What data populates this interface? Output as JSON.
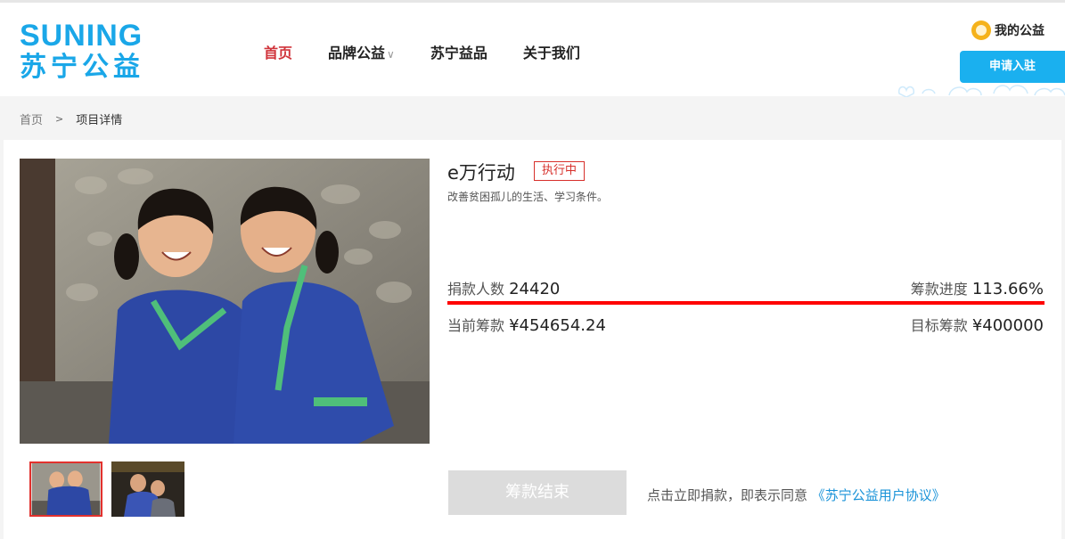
{
  "header": {
    "logo_en": "SUNING",
    "logo_cn": "苏宁公益",
    "nav": [
      {
        "label": "首页",
        "active": true
      },
      {
        "label": "品牌公益",
        "chevron": "∨"
      },
      {
        "label": "苏宁益品"
      },
      {
        "label": "关于我们"
      }
    ],
    "my_charity": "我的公益",
    "apply_button": "申请入驻"
  },
  "breadcrumb": {
    "home": "首页",
    "separator": ">",
    "current": "项目详情"
  },
  "project": {
    "title": "e万行动",
    "status": "执行中",
    "description": "改善贫困孤儿的生活、学习条件。",
    "donors_label": "捐款人数",
    "donors_value": "24420",
    "progress_label": "筹款进度",
    "progress_value": "113.66%",
    "progress_fraction": 1.0,
    "raised_label": "当前筹款",
    "raised_value": "¥454654.24",
    "target_label": "目标筹款",
    "target_value": "¥400000",
    "end_button": "筹款结束",
    "agree_text": "点击立即捐款，即表示同意",
    "agree_link": "《苏宁公益用户协议》"
  },
  "colors": {
    "brand_blue": "#1aa7e8",
    "accent_red": "#d0343b",
    "progress_red": "#ff0000",
    "apply_blue": "#1ab0ef",
    "link_blue": "#1a93d8"
  }
}
